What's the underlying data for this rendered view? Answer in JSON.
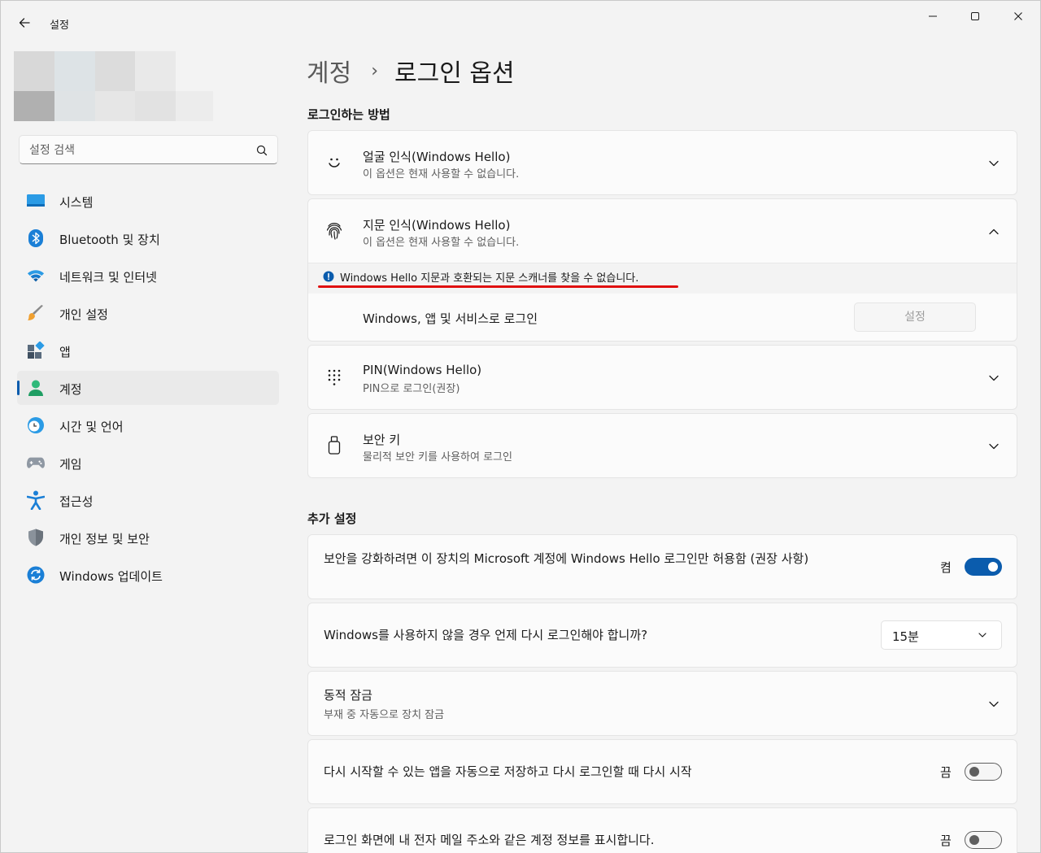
{
  "window": {
    "app_title": "설정",
    "back_icon": "back-arrow-icon",
    "controls": [
      "minimize-icon",
      "maximize-icon",
      "close-icon"
    ]
  },
  "search": {
    "placeholder": "설정 검색"
  },
  "sidebar": {
    "items": [
      {
        "label": "시스템",
        "icon": "system-icon",
        "active": false
      },
      {
        "label": "Bluetooth 및 장치",
        "icon": "bluetooth-icon",
        "active": false
      },
      {
        "label": "네트워크 및 인터넷",
        "icon": "wifi-icon",
        "active": false
      },
      {
        "label": "개인 설정",
        "icon": "brush-icon",
        "active": false
      },
      {
        "label": "앱",
        "icon": "apps-icon",
        "active": false
      },
      {
        "label": "계정",
        "icon": "account-icon",
        "active": true
      },
      {
        "label": "시간 및 언어",
        "icon": "time-language-icon",
        "active": false
      },
      {
        "label": "게임",
        "icon": "gamepad-icon",
        "active": false
      },
      {
        "label": "접근성",
        "icon": "accessibility-icon",
        "active": false
      },
      {
        "label": "개인 정보 및 보안",
        "icon": "shield-icon",
        "active": false
      },
      {
        "label": "Windows 업데이트",
        "icon": "update-icon",
        "active": false
      }
    ]
  },
  "breadcrumb": {
    "parent": "계정",
    "separator": "›",
    "current": "로그인 옵션"
  },
  "sections": {
    "signin_ways": "로그인하는 방법",
    "additional": "추가 설정"
  },
  "signin_options": {
    "face": {
      "title": "얼굴 인식(Windows Hello)",
      "subtitle": "이 옵션은 현재 사용할 수 없습니다.",
      "icon": "face-icon"
    },
    "fingerprint": {
      "title": "지문 인식(Windows Hello)",
      "subtitle": "이 옵션은 현재 사용할 수 없습니다.",
      "icon": "fingerprint-icon",
      "info": "Windows Hello 지문과 호환되는 지문 스캐너를 찾을 수 없습니다.",
      "signin_label": "Windows, 앱 및 서비스로 로그인",
      "setup_button": "설정"
    },
    "pin": {
      "title": "PIN(Windows Hello)",
      "subtitle": "PIN으로 로그인(권장)",
      "icon": "keypad-icon"
    },
    "security_key": {
      "title": "보안 키",
      "subtitle": "물리적 보안 키를 사용하여 로그인",
      "icon": "usb-key-icon"
    }
  },
  "additional_settings": {
    "hello_only": {
      "text": "보안을 강화하려면 이 장치의 Microsoft 계정에 Windows Hello 로그인만 허용함 (권장 사항)",
      "state_label": "켬",
      "on": true
    },
    "require_signin": {
      "text": "Windows를 사용하지 않을 경우 언제 다시 로그인해야 합니까?",
      "value": "15분"
    },
    "dynamic_lock": {
      "title": "동적 잠금",
      "subtitle": "부재 중 자동으로 장치 잠금"
    },
    "restart_apps": {
      "text": "다시 시작할 수 있는 앱을 자동으로 저장하고 다시 로그인할 때 다시 시작",
      "state_label": "끔",
      "on": false
    },
    "show_account": {
      "text": "로그인 화면에 내 전자 메일 주소와 같은 계정 정보를 표시합니다.",
      "state_label": "끔",
      "on": false
    }
  },
  "colors": {
    "accent": "#0b5cad",
    "annotation_red": "#e01010",
    "background": "#f3f3f3",
    "card": "#fbfbfb"
  }
}
